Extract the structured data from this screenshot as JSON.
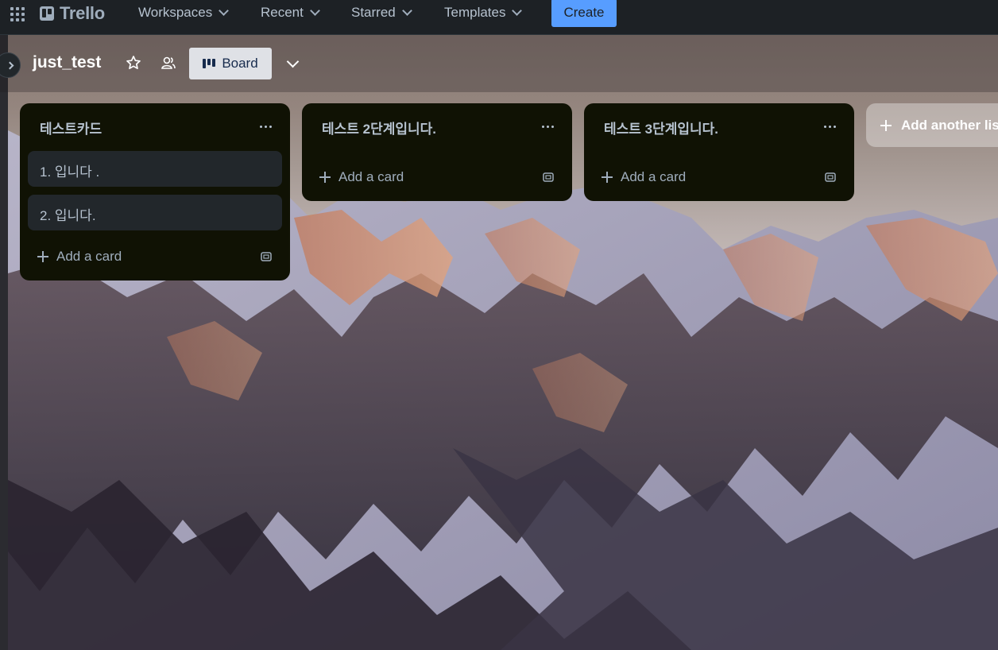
{
  "nav": {
    "app_name": "Trello",
    "menus": [
      {
        "label": "Workspaces"
      },
      {
        "label": "Recent"
      },
      {
        "label": "Starred"
      },
      {
        "label": "Templates"
      }
    ],
    "create_label": "Create",
    "icons": [
      "app-switcher-icon",
      "trello-logo-icon",
      "chevron-down-icon"
    ]
  },
  "board": {
    "title": "just_test",
    "view_label": "Board",
    "background": "mountain-photo"
  },
  "lists": [
    {
      "title": "테스트카드",
      "cards": [
        "1. 입니다 .",
        "2. 입니다."
      ],
      "add_card_label": "Add a card"
    },
    {
      "title": "테스트 2단계입니다.",
      "cards": [],
      "add_card_label": "Add a card"
    },
    {
      "title": "테스트 3단계입니다.",
      "cards": [],
      "add_card_label": "Add a card"
    }
  ],
  "add_list_label": "Add another list",
  "colors": {
    "nav_bg": "#1d2125",
    "create_bg": "#579dff",
    "list_bg": "#101204",
    "card_bg": "#22272b",
    "text": "#b6c2cf"
  }
}
